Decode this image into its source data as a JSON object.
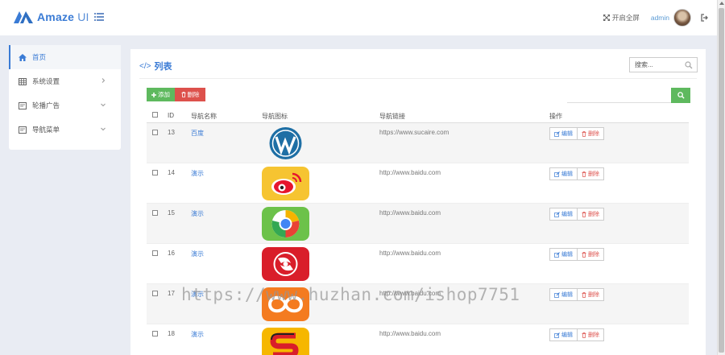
{
  "header": {
    "logo_text": "Amaze",
    "logo_suffix": "UI",
    "fullscreen_label": "开启全屏",
    "admin_label": "admin"
  },
  "sidebar": {
    "items": [
      {
        "label": "首页",
        "icon": "home-icon",
        "active": true
      },
      {
        "label": "系统设置",
        "icon": "grid-icon",
        "chevron": "right"
      },
      {
        "label": "轮播广告",
        "icon": "form-icon",
        "chevron": "down"
      },
      {
        "label": "导航菜单",
        "icon": "form-icon",
        "chevron": "down"
      }
    ]
  },
  "panel": {
    "title_icon": "</>",
    "title": "列表",
    "search_placeholder": "搜索..."
  },
  "toolbar": {
    "add_label": "添加",
    "delete_label": "删除"
  },
  "table": {
    "columns": [
      "ID",
      "导航名称",
      "导航图标",
      "导航链接",
      "操作"
    ],
    "edit_label": "编辑",
    "delete_label": "删除",
    "rows": [
      {
        "id": "13",
        "name": "百度",
        "icon": "wordpress-logo",
        "url": "https://www.sucaire.com"
      },
      {
        "id": "14",
        "name": "演示",
        "icon": "weibo-logo",
        "url": "http://www.baidu.com"
      },
      {
        "id": "15",
        "name": "演示",
        "icon": "chrome-like-logo",
        "url": "http://www.baidu.com"
      },
      {
        "id": "16",
        "name": "演示",
        "icon": "red-swirl-logo",
        "url": "http://www.baidu.com"
      },
      {
        "id": "17",
        "name": "演示",
        "icon": "orange-infinity-logo",
        "url": "http://www.baidu.com"
      },
      {
        "id": "18",
        "name": "演示",
        "icon": "s-logo",
        "url": "http://www.baidu.com"
      }
    ]
  },
  "watermark": "https://www.huzhan.com/ishop7751",
  "colors": {
    "accent": "#3a7bd5",
    "success": "#5eb95e",
    "danger": "#dd514c"
  }
}
